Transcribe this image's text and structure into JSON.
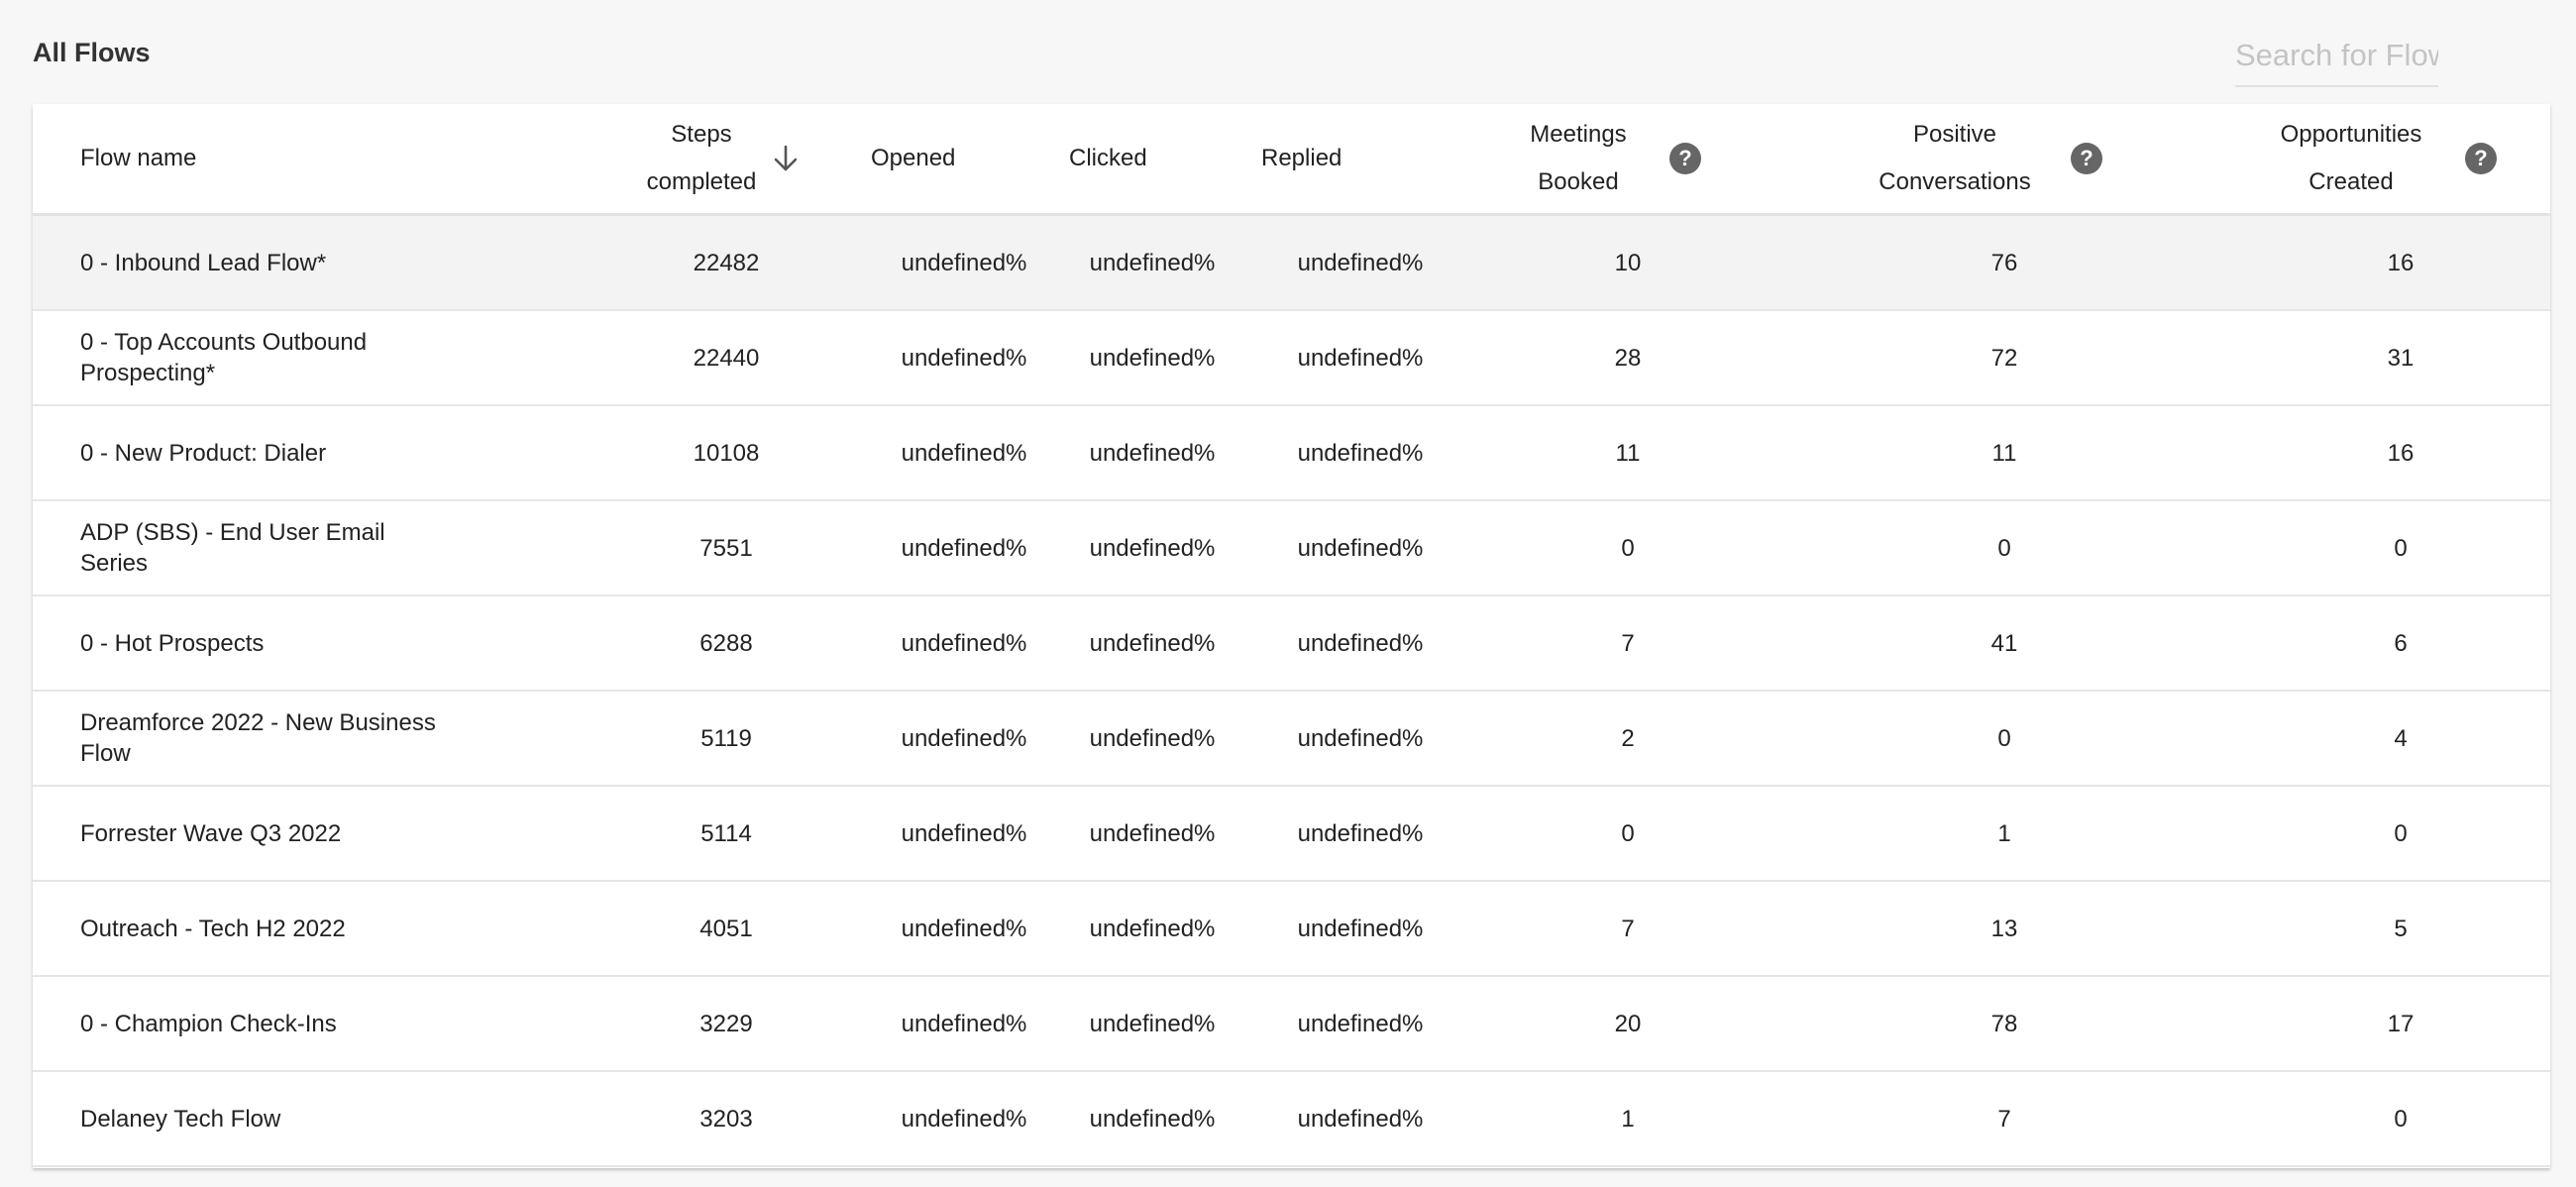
{
  "header": {
    "title": "All Flows",
    "search_placeholder": "Search for Flows"
  },
  "table": {
    "columns": {
      "flow_name": "Flow name",
      "steps_line1": "Steps",
      "steps_line2": "completed",
      "opened": "Opened",
      "clicked": "Clicked",
      "replied": "Replied",
      "meetings_line1": "Meetings",
      "meetings_line2": "Booked",
      "positive_line1": "Positive",
      "positive_line2": "Conversations",
      "opps_line1": "Opportunities",
      "opps_line2": "Created"
    },
    "help_glyph": "?",
    "sort_icon": "arrow-down-icon",
    "rows": [
      {
        "name": "0 - Inbound Lead Flow*",
        "steps": "22482",
        "opened": "undefined%",
        "clicked": "undefined%",
        "replied": "undefined%",
        "meetings": "10",
        "positive": "76",
        "opps": "16"
      },
      {
        "name": "0 - Top Accounts Outbound Prospecting*",
        "steps": "22440",
        "opened": "undefined%",
        "clicked": "undefined%",
        "replied": "undefined%",
        "meetings": "28",
        "positive": "72",
        "opps": "31"
      },
      {
        "name": "0 - New Product: Dialer",
        "steps": "10108",
        "opened": "undefined%",
        "clicked": "undefined%",
        "replied": "undefined%",
        "meetings": "11",
        "positive": "11",
        "opps": "16"
      },
      {
        "name": "ADP (SBS) - End User Email Series",
        "steps": "7551",
        "opened": "undefined%",
        "clicked": "undefined%",
        "replied": "undefined%",
        "meetings": "0",
        "positive": "0",
        "opps": "0"
      },
      {
        "name": "0 - Hot Prospects",
        "steps": "6288",
        "opened": "undefined%",
        "clicked": "undefined%",
        "replied": "undefined%",
        "meetings": "7",
        "positive": "41",
        "opps": "6"
      },
      {
        "name": "Dreamforce 2022 - New Business Flow",
        "steps": "5119",
        "opened": "undefined%",
        "clicked": "undefined%",
        "replied": "undefined%",
        "meetings": "2",
        "positive": "0",
        "opps": "4"
      },
      {
        "name": "Forrester Wave Q3 2022",
        "steps": "5114",
        "opened": "undefined%",
        "clicked": "undefined%",
        "replied": "undefined%",
        "meetings": "0",
        "positive": "1",
        "opps": "0"
      },
      {
        "name": "Outreach - Tech H2 2022",
        "steps": "4051",
        "opened": "undefined%",
        "clicked": "undefined%",
        "replied": "undefined%",
        "meetings": "7",
        "positive": "13",
        "opps": "5"
      },
      {
        "name": "0 - Champion Check-Ins",
        "steps": "3229",
        "opened": "undefined%",
        "clicked": "undefined%",
        "replied": "undefined%",
        "meetings": "20",
        "positive": "78",
        "opps": "17"
      },
      {
        "name": "Delaney Tech Flow",
        "steps": "3203",
        "opened": "undefined%",
        "clicked": "undefined%",
        "replied": "undefined%",
        "meetings": "1",
        "positive": "7",
        "opps": "0"
      }
    ]
  }
}
